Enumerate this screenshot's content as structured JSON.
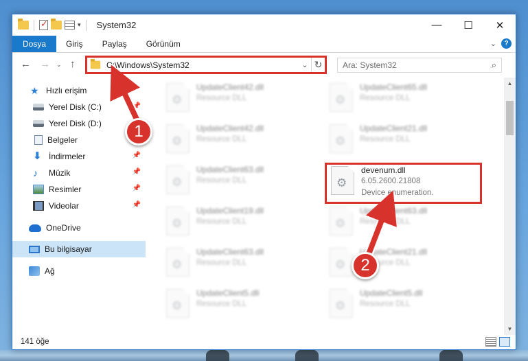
{
  "window": {
    "title": "System32",
    "controls": {
      "minimize": "—",
      "maximize": "☐",
      "close": "✕"
    }
  },
  "ribbon": {
    "tabs": [
      "Dosya",
      "Giriş",
      "Paylaş",
      "Görünüm"
    ]
  },
  "navigation": {
    "address": "C:\\Windows\\System32",
    "search_placeholder": "Ara: System32"
  },
  "sidebar": {
    "items": [
      {
        "label": "Hızlı erişim",
        "icon": "star-icon",
        "pinned": false
      },
      {
        "label": "Yerel Disk (C:)",
        "icon": "disk-icon",
        "pinned": true
      },
      {
        "label": "Yerel Disk (D:)",
        "icon": "disk-icon",
        "pinned": false
      },
      {
        "label": "Belgeler",
        "icon": "documents-icon",
        "pinned": true
      },
      {
        "label": "İndirmeler",
        "icon": "download-icon",
        "pinned": true
      },
      {
        "label": "Müzik",
        "icon": "music-icon",
        "pinned": true
      },
      {
        "label": "Resimler",
        "icon": "pictures-icon",
        "pinned": true
      },
      {
        "label": "Videolar",
        "icon": "videos-icon",
        "pinned": true
      },
      {
        "label": "OneDrive",
        "icon": "onedrive-icon",
        "pinned": false
      },
      {
        "label": "Bu bilgisayar",
        "icon": "computer-icon",
        "pinned": false,
        "selected": true
      },
      {
        "label": "Ağ",
        "icon": "network-icon",
        "pinned": false
      }
    ]
  },
  "files": [
    {
      "name": "UpdateClient42.dll",
      "type": "Resource DLL"
    },
    {
      "name": "UpdateClient65.dll",
      "type": "Resource DLL"
    },
    {
      "name": "UpdateClient42.dll",
      "type": "Resource DLL"
    },
    {
      "name": "UpdateClient21.dll",
      "type": "Resource DLL"
    },
    {
      "name": "UpdateClient63.dll",
      "type": "Resource DLL"
    },
    {
      "name": "devenum.dll",
      "version": "6.05.2600.21808",
      "description": "Device enumeration.",
      "highlighted": true
    },
    {
      "name": "UpdateClient19.dll",
      "type": "Resource DLL"
    },
    {
      "name": "UpdateClient63.dll",
      "type": "Resource DLL"
    },
    {
      "name": "UpdateClient63.dll",
      "type": "Resource DLL"
    },
    {
      "name": "UpdateClient21.dll",
      "type": "Resource DLL"
    },
    {
      "name": "UpdateClient5.dll",
      "type": "Resource DLL"
    },
    {
      "name": "UpdateClient5.dll",
      "type": "Resource DLL"
    }
  ],
  "status": {
    "item_count": "141 öğe"
  },
  "annotations": {
    "step1": "1",
    "step2": "2",
    "color": "#d8322d"
  }
}
